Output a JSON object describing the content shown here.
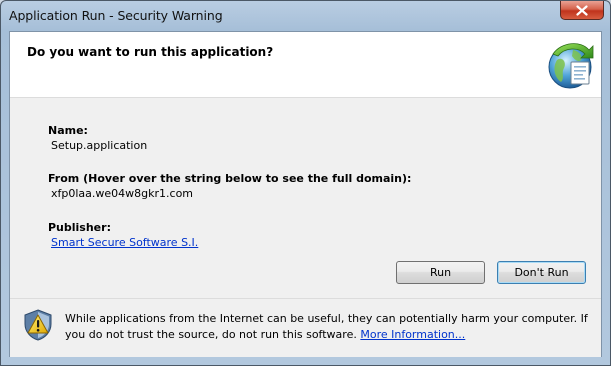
{
  "window": {
    "title": "Application Run - Security Warning",
    "close_label": "Close"
  },
  "header": {
    "question": "Do you want to run this application?",
    "icon": "application-globe-icon"
  },
  "details": {
    "name_label": "Name:",
    "name_value": "Setup.application",
    "from_label": "From (Hover over the string below to see the full domain):",
    "from_value": "xfp0laa.we04w8gkr1.com",
    "publisher_label": "Publisher:",
    "publisher_value": "Smart Secure Software S.I."
  },
  "buttons": {
    "run": "Run",
    "dont_run": "Don't Run"
  },
  "footer": {
    "icon": "warning-shield-icon",
    "warning_text": "While applications from the Internet can be useful, they can potentially harm your computer. If you do not trust the source, do not run this software.",
    "more_info_link": "More Information..."
  },
  "colors": {
    "link": "#0033cc",
    "close_button": "#c0331c"
  }
}
